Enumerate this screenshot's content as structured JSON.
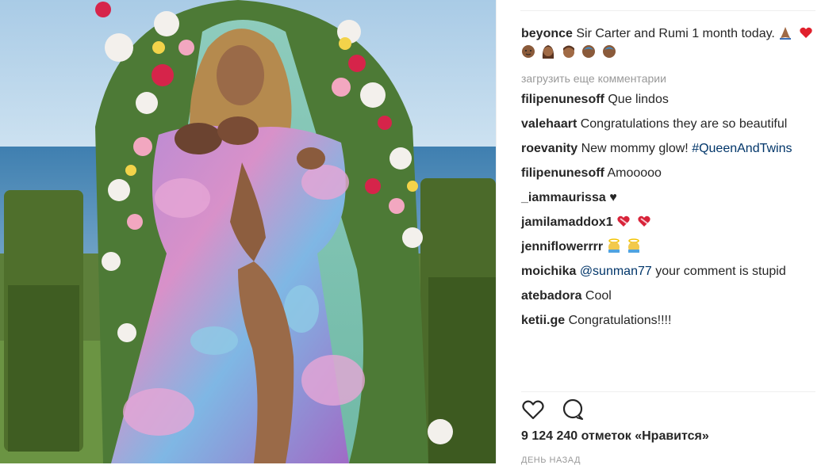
{
  "post": {
    "author": "beyonce",
    "caption": "Sir Carter and Rumi 1 month today.",
    "caption_emojis": [
      "praying-hands-emoji",
      "red-heart-emoji",
      "baby-emoji",
      "woman-emoji",
      "man-emoji",
      "baby-emoji",
      "baby-emoji"
    ]
  },
  "load_more": "загрузить еще комментарии",
  "comments": [
    {
      "user": "filipenunesoff",
      "text": "Que lindos"
    },
    {
      "user": "valehaart",
      "text": "Congratulations they are so beautiful"
    },
    {
      "user": "roevanity",
      "text": "New mommy glow!",
      "tag": "#QueenAndTwins"
    },
    {
      "user": "filipenunesoff",
      "text": "Amooooo"
    },
    {
      "user": "_iammaurissa",
      "text": "♥"
    },
    {
      "user": "jamilamaddox1",
      "text": ""
    },
    {
      "user": "jenniflowerrrr",
      "text": ""
    },
    {
      "user": "moichika",
      "mention": "@sunman77",
      "text": "your comment is stupid"
    },
    {
      "user": "atebadora",
      "text": "Cool"
    },
    {
      "user": "ketii.ge",
      "text": "Congratulations!!!!"
    }
  ],
  "likes": "9 124 240 отметок «Нравится»",
  "time": "день назад",
  "icons": {
    "like": "heart-outline-icon",
    "comment": "comment-bubble-icon"
  },
  "colors": {
    "text": "#262626",
    "muted": "#999999",
    "link": "#003569",
    "heart": "#ed4956"
  }
}
